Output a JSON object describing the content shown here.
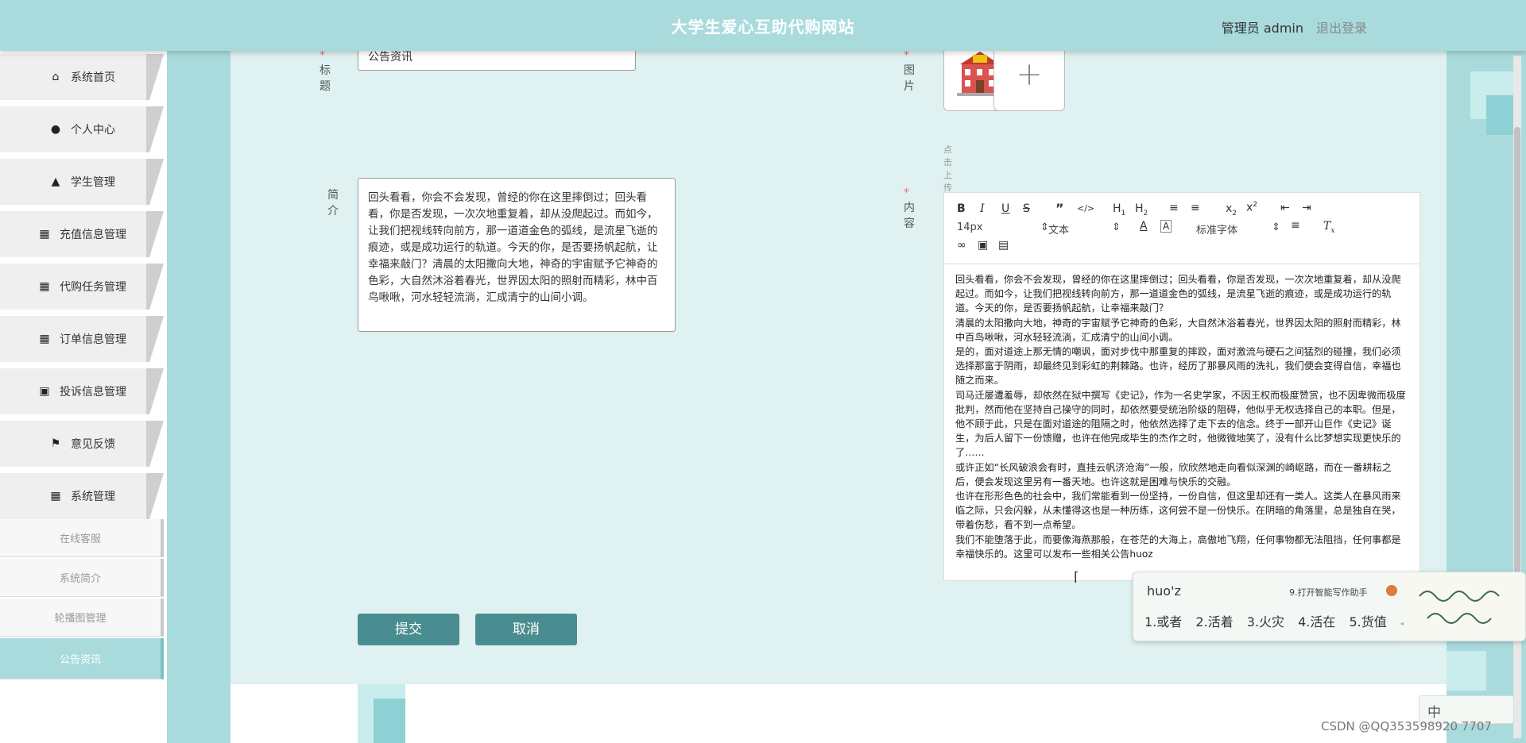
{
  "header": {
    "site_title": "大学生爱心互助代购网站",
    "admin_label": "管理员 admin",
    "logout": "退出登录"
  },
  "sidebar": {
    "items": [
      {
        "label": "系统首页",
        "icon": "home-icon"
      },
      {
        "label": "个人中心",
        "icon": "user-icon"
      },
      {
        "label": "学生管理",
        "icon": "user-tie-icon"
      },
      {
        "label": "充值信息管理",
        "icon": "grid-icon"
      },
      {
        "label": "代购任务管理",
        "icon": "grid-icon"
      },
      {
        "label": "订单信息管理",
        "icon": "grid-icon"
      },
      {
        "label": "投诉信息管理",
        "icon": "briefcase-icon"
      },
      {
        "label": "意见反馈",
        "icon": "flag-icon"
      },
      {
        "label": "系统管理",
        "icon": "grid-icon"
      }
    ],
    "subitems": [
      {
        "label": "在线客服"
      },
      {
        "label": "系统简介"
      },
      {
        "label": "轮播图管理"
      },
      {
        "label": "公告资讯",
        "active": true
      }
    ]
  },
  "form": {
    "title_label": "标题",
    "title_value": "公告资讯",
    "image_label": "图片",
    "upload_hint": "点击上传图片",
    "add_symbol": "+",
    "intro_label": "简介",
    "intro_value": "回头看看，你会不会发现，曾经的你在这里摔倒过；回头看看，你是否发现，一次次地重复着，却从没爬起过。而如今，让我们把视线转向前方，那一道道金色的弧线，是流星飞逝的痕迹，或是成功运行的轨道。今天的你，是否要扬帆起航，让幸福来敲门？清晨的太阳撒向大地，神奇的宇宙赋予它神奇的色彩，大自然沐浴着春光，世界因太阳的照射而精彩，林中百鸟啾啾，河水轻轻流淌，汇成清宁的山间小调。",
    "content_label": "内容",
    "required_mark": "*",
    "submit": "提交",
    "cancel": "取消"
  },
  "editor": {
    "font_size": "14px",
    "block_format": "文本",
    "font_family": "标准字体",
    "paragraphs": [
      "回头看看，你会不会发现，曾经的你在这里摔倒过；回头看看，你是否发现，一次次地重复着，却从没爬起过。而如今，让我们把视线转向前方，那一道道金色的弧线，是流星飞逝的痕迹，或是成功运行的轨道。今天的你，是否要扬帆起航，让幸福来敲门？",
      "清晨的太阳撒向大地，神奇的宇宙赋予它神奇的色彩，大自然沐浴着春光，世界因太阳的照射而精彩，林中百鸟啾啾，河水轻轻流淌，汇成清宁的山间小调。",
      "是的，面对道途上那无情的嘲讽，面对步伐中那重复的摔跤，面对激流与硬石之间猛烈的碰撞，我们必须选择那富于阴雨，却最终见到彩虹的荆棘路。也许，经历了那暴风雨的洗礼，我们便会变得自信，幸福也随之而来。",
      "司马迁屡遭羞辱，却依然在狱中撰写《史记》，作为一名史学家，不因王权而极度赞赏，也不因卑微而极度批判，然而他在坚持自己操守的同时，却依然要受统治阶级的阻碍，他似乎无权选择自己的本职。但是，他不顾于此，只是在面对道途的阻隔之时，他依然选择了走下去的信念。终于一部开山巨作《史记》诞生，为后人留下一份馈赠，也许在他完成毕生的杰作之时，他微微地笑了，没有什么比梦想实现更快乐的了……",
      "或许正如“长风破浪会有时，直挂云帆济沧海”一般，欣欣然地走向看似深渊的崎岖路，而在一番耕耘之后，便会发现这里另有一番天地。也许这就是困难与快乐的交融。",
      "也许在形形色色的社会中，我们常能看到一份坚持，一份自信，但这里却还有一类人。这类人在暴风雨来临之际，只会闪躲，从未懂得这也是一种历练，这何尝不是一份快乐。在阴暗的角落里，总是独自在哭，带着伤愁，看不到一点希望。",
      "我们不能堕落于此，而要像海燕那般，在苍茫的大海上，高傲地飞翔，任何事物都无法阻挡，任何事都是幸福快乐的。这里可以发布一些相关公告huoz"
    ]
  },
  "ime": {
    "input": "huo'z",
    "assist": "9.打开智能写作助手",
    "candidates": [
      "1.或者",
      "2.活着",
      "3.火灾",
      "4.活在",
      "5.货值"
    ],
    "mode": "中"
  },
  "watermark": "CSDN @QQ353598920 7707"
}
